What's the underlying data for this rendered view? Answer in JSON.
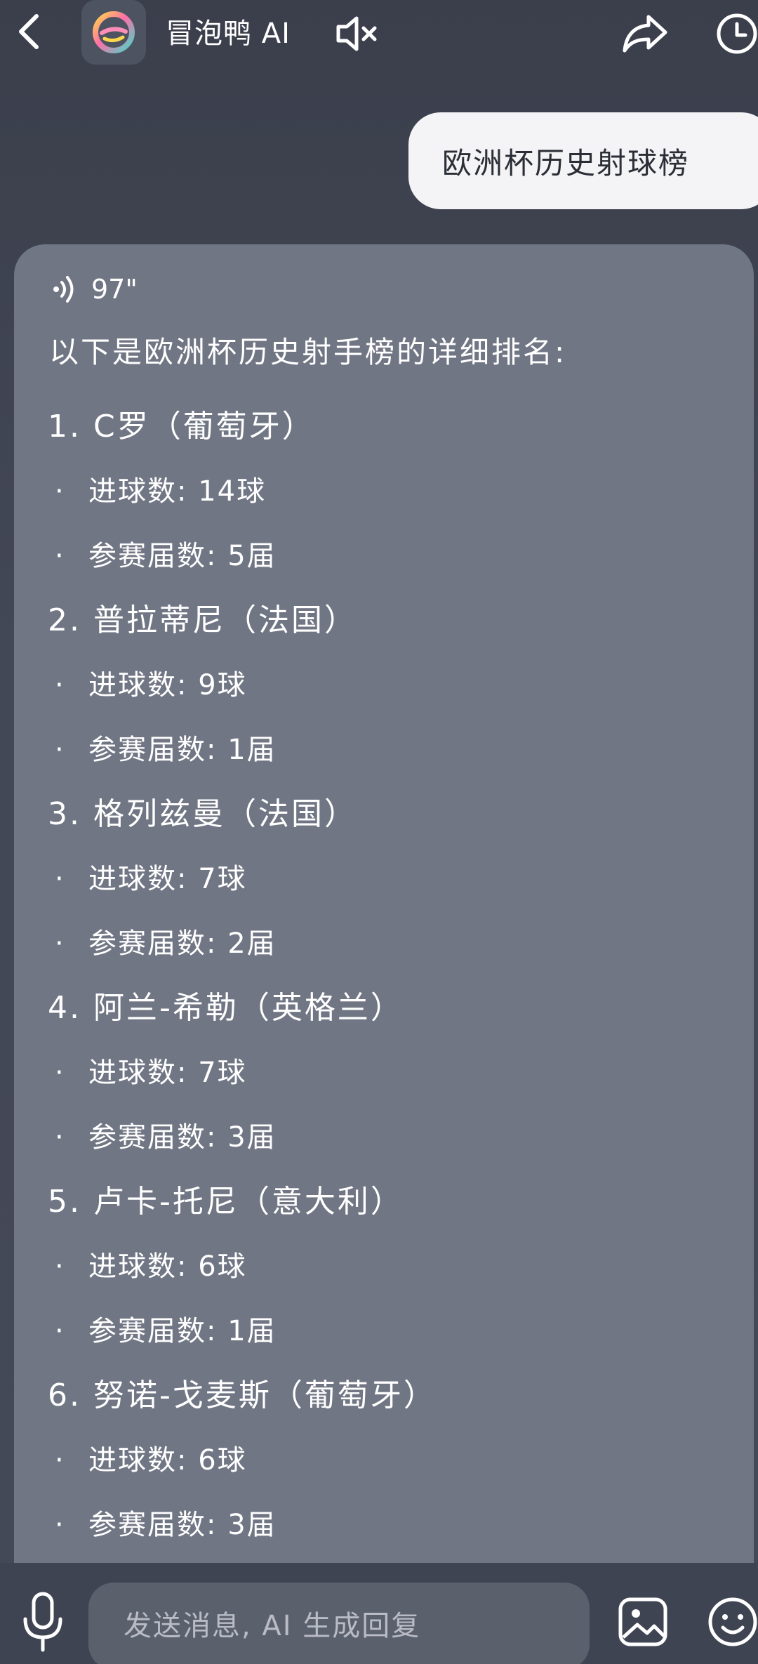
{
  "header": {
    "title": "冒泡鸭 AI"
  },
  "user_message": {
    "text": "欧洲杯历史射球榜"
  },
  "ai_message": {
    "voice_duration": "97\"",
    "intro": "以下是欧洲杯历史射手榜的详细排名:",
    "entries": [
      {
        "title": "1. C罗（葡萄牙）",
        "goals": "进球数: 14球",
        "tournaments": "参赛届数: 5届"
      },
      {
        "title": "2. 普拉蒂尼（法国）",
        "goals": "进球数: 9球",
        "tournaments": "参赛届数: 1届"
      },
      {
        "title": "3. 格列兹曼（法国）",
        "goals": "进球数: 7球",
        "tournaments": "参赛届数: 2届"
      },
      {
        "title": "4. 阿兰-希勒（英格兰）",
        "goals": "进球数: 7球",
        "tournaments": "参赛届数: 3届"
      },
      {
        "title": "5. 卢卡-托尼（意大利）",
        "goals": "进球数: 6球",
        "tournaments": "参赛届数: 1届"
      },
      {
        "title": "6. 努诺-戈麦斯（葡萄牙）",
        "goals": "进球数: 6球",
        "tournaments": "参赛届数: 3届"
      }
    ],
    "bullet": "·"
  },
  "input": {
    "placeholder": "发送消息, AI 生成回复"
  },
  "colors": {
    "background": "#434855",
    "ai_bubble": "#717684",
    "user_bubble": "#f4f4f6",
    "input_box": "#5b606d"
  }
}
